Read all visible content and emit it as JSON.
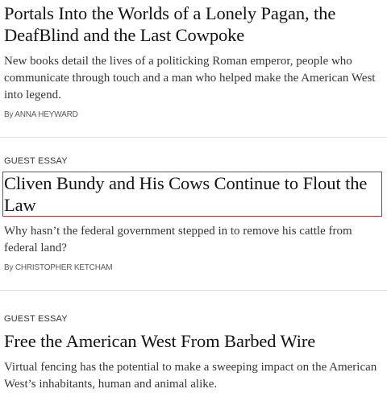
{
  "articles": [
    {
      "kicker": "",
      "headline": "Portals Into the Worlds of a Lonely Pagan, the DeafBlind and the Last Cowpoke",
      "summary": "New books detail the lives of a politicking Roman emperor, people who communicate through touch and a man who helped make the American West into legend.",
      "byline": "By ANNA HEYWARD"
    },
    {
      "kicker": "GUEST ESSAY",
      "headline": "Cliven Bundy and His Cows Continue to Flout the Law",
      "summary": "Why hasn’t the federal government stepped in to remove his cattle from federal land?",
      "byline": "By CHRISTOPHER KETCHAM"
    },
    {
      "kicker": "GUEST ESSAY",
      "headline": "Free the American West From Barbed Wire",
      "summary": "Virtual fencing has the potential to make a sweeping impact on the American West’s inhabitants, human and animal alike.",
      "byline": ""
    }
  ],
  "colors": {
    "focus_outline": "#b5333b",
    "divider": "#e2e2e2"
  }
}
